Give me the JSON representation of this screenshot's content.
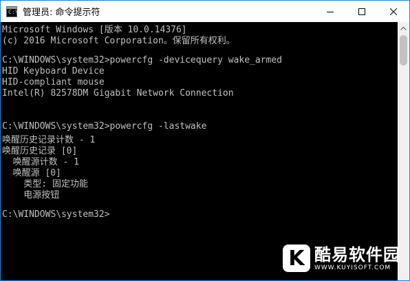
{
  "window": {
    "title": "管理员: 命令提示符",
    "icon_label": "C:\\"
  },
  "controls": {
    "minimize_icon": "minimize-icon",
    "maximize_icon": "maximize-icon",
    "close_icon": "close-icon"
  },
  "console": {
    "lines": [
      "Microsoft Windows [版本 10.0.14376]",
      "(c) 2016 Microsoft Corporation。保留所有权利。",
      "",
      "C:\\WINDOWS\\system32>powercfg -devicequery wake_armed",
      "HID Keyboard Device",
      "HID-compliant mouse",
      "Intel(R) 82578DM Gigabit Network Connection",
      "",
      "",
      "C:\\WINDOWS\\system32>powercfg -lastwake",
      "唤醒历史记录计数 - 1",
      "唤醒历史记录 [0]",
      "  唤醒源计数 - 1",
      "  唤醒源 [0]",
      "    类型: 固定功能",
      "    电源按钮",
      "",
      "C:\\WINDOWS\\system32>"
    ]
  },
  "watermark": {
    "logo_letter": "K",
    "name": "酷易软件园",
    "url": "WWW.KUYISOFT.COM"
  },
  "colors": {
    "console_bg": "#000000",
    "console_fg": "#c0c0c0",
    "window_border": "#1883d7",
    "titlebar_bg": "#ffffff"
  }
}
